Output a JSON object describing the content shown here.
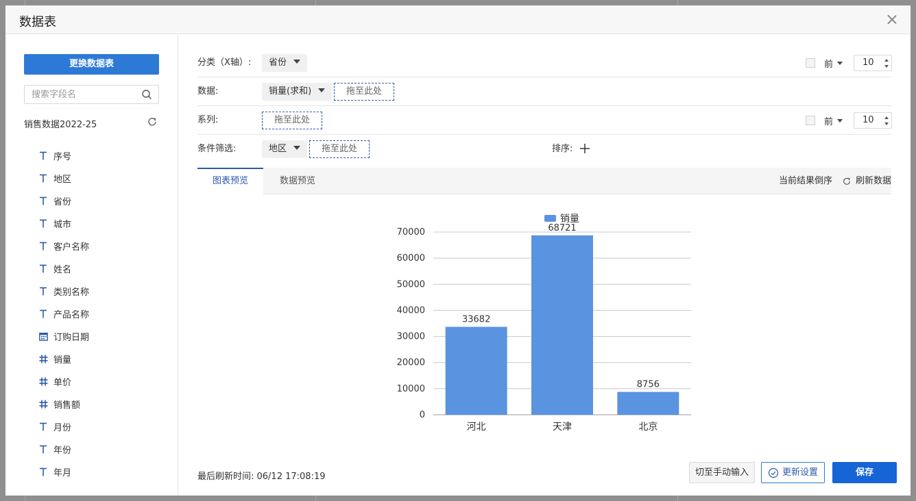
{
  "modal": {
    "title": "数据表"
  },
  "sidebar": {
    "switch_button": "更换数据表",
    "search_placeholder": "搜索字段名",
    "table_name": "销售数据2022-25",
    "fields": [
      {
        "label": "序号",
        "type": "text"
      },
      {
        "label": "地区",
        "type": "text"
      },
      {
        "label": "省份",
        "type": "text"
      },
      {
        "label": "城市",
        "type": "text"
      },
      {
        "label": "客户名称",
        "type": "text"
      },
      {
        "label": "姓名",
        "type": "text"
      },
      {
        "label": "类别名称",
        "type": "text"
      },
      {
        "label": "产品名称",
        "type": "text"
      },
      {
        "label": "订购日期",
        "type": "date"
      },
      {
        "label": "销量",
        "type": "number"
      },
      {
        "label": "单价",
        "type": "number"
      },
      {
        "label": "销售额",
        "type": "number"
      },
      {
        "label": "月份",
        "type": "text"
      },
      {
        "label": "年份",
        "type": "text"
      },
      {
        "label": "年月",
        "type": "text"
      }
    ]
  },
  "config": {
    "category_label": "分类（X轴）:",
    "category_value": "省份",
    "data_label": "数据:",
    "data_value": "销量(求和)",
    "series_label": "系列:",
    "filter_label": "条件筛选:",
    "filter_value": "地区",
    "dropzone_text": "拖至此处",
    "sort_label": "排序:",
    "top_label": "前",
    "top_value": "10"
  },
  "tabs": {
    "chart_preview": "图表预览",
    "data_preview": "数据预览",
    "reverse_order": "当前结果倒序",
    "refresh_data": "刷新数据"
  },
  "footer": {
    "last_refresh": "最后刷新时间: 06/12 17:08:19",
    "manual_input": "切至手动输入",
    "update_settings": "更新设置",
    "save": "保存"
  },
  "colors": {
    "bar": "#5a93e0",
    "primary": "#1565d6",
    "accent": "#2d5aa8"
  },
  "chart_data": {
    "type": "bar",
    "categories": [
      "河北",
      "天津",
      "北京"
    ],
    "series": [
      {
        "name": "销量",
        "values": [
          33682,
          68721,
          8756
        ]
      }
    ],
    "ylim": [
      0,
      70000
    ],
    "yticks": [
      0,
      10000,
      20000,
      30000,
      40000,
      50000,
      60000,
      70000
    ],
    "legend": "top-center",
    "grid": true,
    "data_labels": true
  }
}
